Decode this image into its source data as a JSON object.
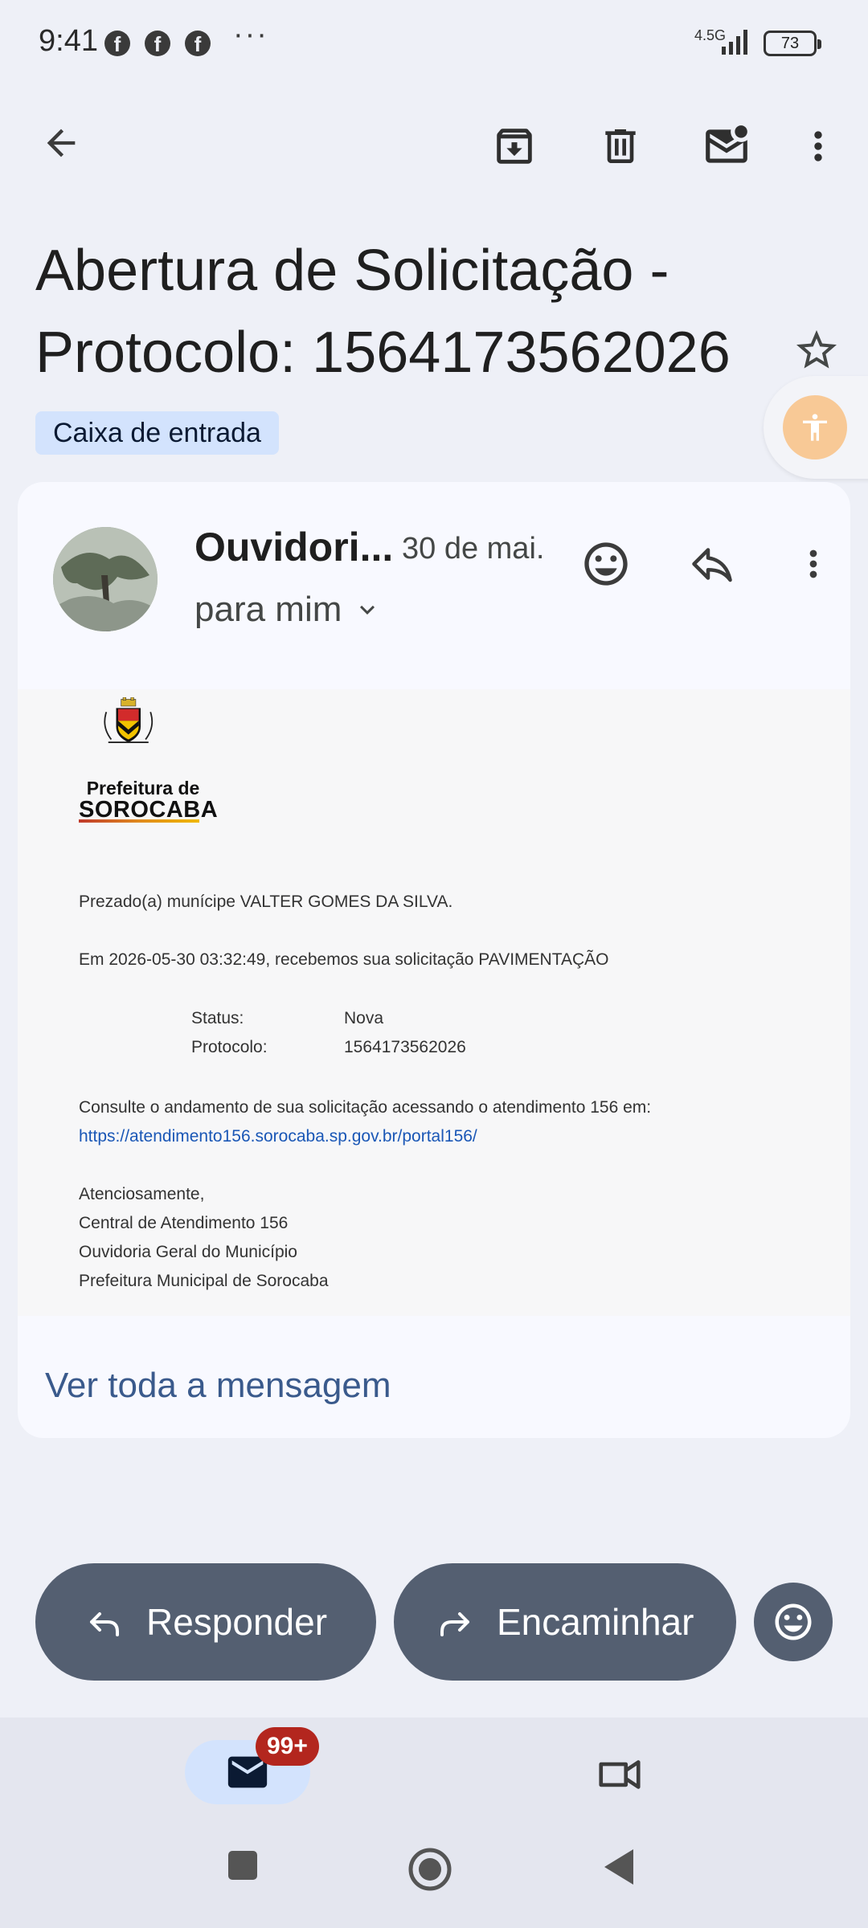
{
  "status_bar": {
    "time": "9:41",
    "notification_icons": [
      "facebook-icon",
      "facebook-icon",
      "facebook-icon"
    ],
    "more_dots": "···",
    "network": "4.5G",
    "battery": "73"
  },
  "toolbar": {
    "back_icon": "arrow-left-icon",
    "archive_icon": "archive-icon",
    "delete_icon": "trash-icon",
    "mark_unread_icon": "mail-unread-icon",
    "more_icon": "more-vert-icon"
  },
  "subject": {
    "line1": "Abertura de Solicitação -",
    "line2": "Protocolo: 1564173562026",
    "label": "Caixa de entrada"
  },
  "message": {
    "sender": "Ouvidori...",
    "date": "30 de mai.",
    "recipient": "para mim",
    "logo": {
      "line1": "Prefeitura de",
      "line2": "SOROCABA"
    },
    "greeting": "Prezado(a) munícipe VALTER GOMES DA SILVA.",
    "received": "Em 2026-05-30 03:32:49, recebemos sua solicitação PAVIMENTAÇÃO",
    "status_label": "Status:",
    "status_value": "Nova",
    "protocol_label": "Protocolo:",
    "protocol_value": "1564173562026",
    "consult": "Consulte o andamento de sua solicitação acessando o atendimento 156 em:",
    "link": "https://atendimento156.sorocaba.sp.gov.br/portal156/",
    "sign1": "Atenciosamente,",
    "sign2": "Central de Atendimento 156",
    "sign3": "Ouvidoria Geral do Município",
    "sign4": "Prefeitura Municipal de Sorocaba",
    "view_full": "Ver toda a mensagem"
  },
  "actions": {
    "reply": "Responder",
    "forward": "Encaminhar"
  },
  "bottom_nav": {
    "mail_badge": "99+"
  },
  "colors": {
    "background": "#eef0f7",
    "card": "#f8f9ff",
    "pill": "#545f71",
    "chip": "#d3e3fd",
    "badge": "#b3261e",
    "link": "#1a57b6"
  }
}
